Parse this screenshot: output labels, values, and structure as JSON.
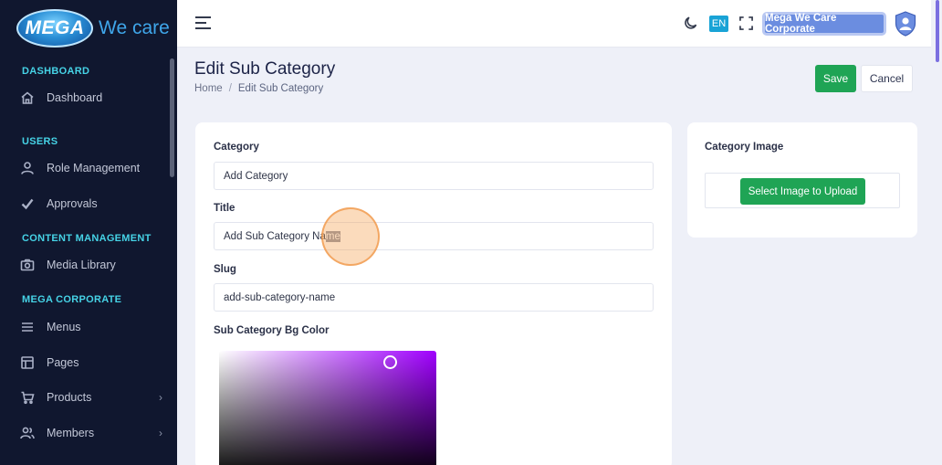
{
  "brand": {
    "mark": "MEGA",
    "tagline": "We care"
  },
  "sidebar": {
    "sections": [
      {
        "title": "DASHBOARD"
      },
      {
        "title": "USERS"
      },
      {
        "title": "CONTENT MANAGEMENT"
      },
      {
        "title": "MEGA CORPORATE"
      }
    ],
    "items": [
      {
        "label": "Dashboard",
        "icon": "home-icon"
      },
      {
        "label": "Role Management",
        "icon": "user-icon"
      },
      {
        "label": "Approvals",
        "icon": "check-icon"
      },
      {
        "label": "Media Library",
        "icon": "camera-icon"
      },
      {
        "label": "Menus",
        "icon": "menu-lines-icon"
      },
      {
        "label": "Pages",
        "icon": "layout-icon"
      },
      {
        "label": "Products",
        "icon": "cart-icon",
        "has_submenu": true
      },
      {
        "label": "Members",
        "icon": "users-icon",
        "has_submenu": true
      }
    ]
  },
  "header": {
    "language": "EN",
    "account_label": "Mega We Care Corporate",
    "theme_icon": "moon-icon",
    "fullscreen_icon": "fullscreen-icon",
    "avatar_icon": "avatar-icon"
  },
  "page": {
    "title": "Edit Sub Category",
    "breadcrumb": {
      "home": "Home",
      "separator": "/",
      "current": "Edit Sub Category"
    },
    "save_label": "Save",
    "cancel_label": "Cancel"
  },
  "form": {
    "category_label": "Category",
    "category_value": "Add Category",
    "title_label": "Title",
    "title_value_prefix": "Add Sub Category Na",
    "title_value_selected": "me",
    "slug_label": "Slug",
    "slug_value": "add-sub-category-name",
    "bg_color_label": "Sub Category Bg Color"
  },
  "image_panel": {
    "label": "Category Image",
    "upload_button": "Select Image to Upload"
  },
  "colors": {
    "sidebar_bg": "#10172f",
    "section_accent": "#46d3e6",
    "primary_green": "#1fa455",
    "account_button": "#6b8de0",
    "picker_hue": "#a000ff"
  }
}
